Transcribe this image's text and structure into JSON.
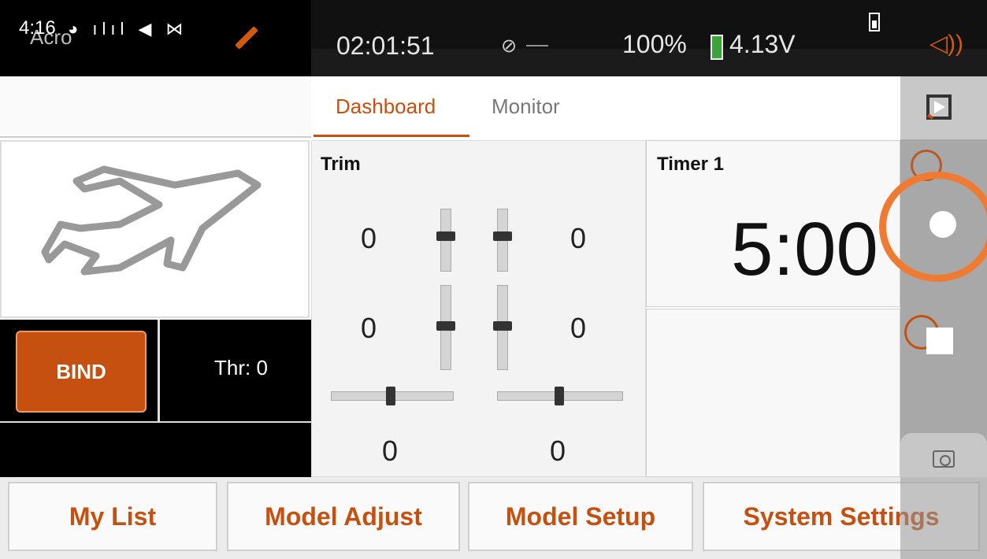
{
  "status_bar": {
    "clock": "4:16",
    "mode": "Acro",
    "system_icons": "◕ ılıl ◀ ⋈",
    "timer": "02:01:51",
    "link_dash": "—",
    "battery_percent": "100%",
    "voltage": "4.13V"
  },
  "tabs": [
    {
      "label": "Dashboard",
      "active": true
    },
    {
      "label": "Monitor",
      "active": false
    }
  ],
  "model": {
    "bind_label": "BIND",
    "throttle": "Thr: 0"
  },
  "trim": {
    "title": "Trim",
    "left_vertical_upper": "0",
    "right_vertical_upper": "0",
    "left_vertical_lower": "0",
    "right_vertical_lower": "0",
    "left_horizontal": "0",
    "right_horizontal": "0"
  },
  "timer_widget": {
    "title": "Timer 1",
    "value": "5:00"
  },
  "bottom_nav": {
    "my_list": "My List",
    "model_adjust": "Model Adjust",
    "model_setup": "Model Setup",
    "system_settings": "System Settings"
  },
  "colors": {
    "accent": "#c5500f",
    "highlight_ring": "#ef7a32",
    "battery_green": "#3ca33c"
  },
  "icons": [
    "pencil-icon",
    "link-icon",
    "battery-icon",
    "speaker-icon",
    "collapse-icon",
    "clock-icon",
    "record-icon",
    "stop-icon",
    "camera-icon",
    "airplane-icon"
  ]
}
